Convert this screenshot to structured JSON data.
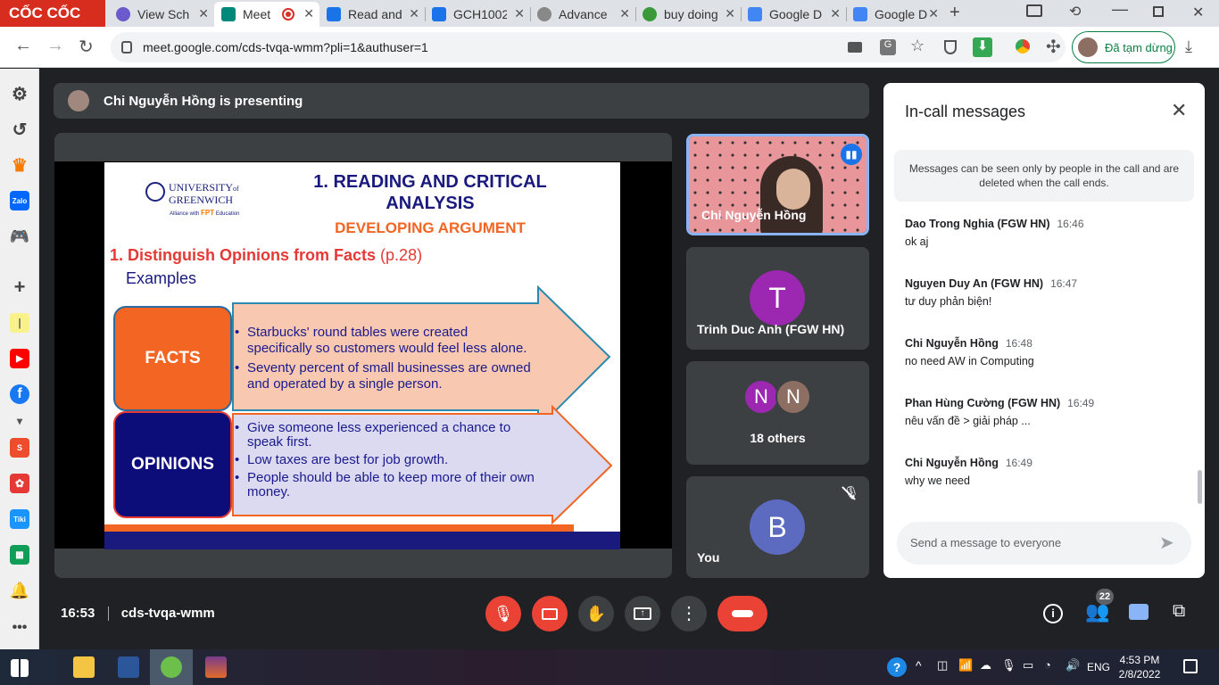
{
  "browser": {
    "logo": "CỐC CỐC",
    "tabs": [
      {
        "label": "View Sch",
        "icon": "view-schedule-icon",
        "color": "#6a5acd"
      },
      {
        "label": "Meet",
        "icon": "meet-icon",
        "color": "#00897b",
        "active": true
      },
      {
        "label": "Read and",
        "icon": "docs-icon",
        "color": "#1a73e8"
      },
      {
        "label": "GCH1002",
        "icon": "docs-icon",
        "color": "#1a73e8"
      },
      {
        "label": "Advance",
        "icon": "globe-icon",
        "color": "#888888"
      },
      {
        "label": "buy doing",
        "icon": "coccoc-icon",
        "color": "#3a9a3a"
      },
      {
        "label": "Google D",
        "icon": "google-translate-icon",
        "color": "#4285f4"
      },
      {
        "label": "Google D",
        "icon": "google-translate-icon",
        "color": "#4285f4"
      }
    ],
    "url": "meet.google.com/cds-tvqa-wmm?pli=1&authuser=1",
    "pause_label": "Đã tạm dừng"
  },
  "meet": {
    "presenting_text": "Chi Nguyễn Hồng is presenting",
    "slide": {
      "logo_line1": "UNIVERSITY",
      "logo_of": "of",
      "logo_line2": "GREENWICH",
      "logo_alliance": "Alliance with",
      "logo_fpt": "FPT",
      "logo_edu": "Education",
      "title_line1": "1. READING AND CRITICAL",
      "title_line2": "ANALYSIS",
      "subtitle": "DEVELOPING ARGUMENT",
      "heading": "1. Distinguish Opinions from Facts",
      "heading_page": "(p.28)",
      "examples": "Examples",
      "facts_label": "FACTS",
      "opinions_label": "OPINIONS",
      "facts": [
        {
          "line1": "Starbucks' round tables were created",
          "line2": "specifically so customers would feel less alone."
        },
        {
          "line1": "Seventy percent of small businesses are owned",
          "line2": "and operated by a single person."
        }
      ],
      "opinions": [
        {
          "line1": "Give someone less experienced a chance to",
          "line2": "speak first."
        },
        {
          "line1": "Low taxes are best for job growth.",
          "line2": ""
        },
        {
          "line1": "People should be able to keep more of their own",
          "line2": "money."
        }
      ]
    },
    "tiles": {
      "presenter_name": "Chi Nguyễn Hồng",
      "t_initial": "T",
      "t_name": "Trinh Duc Anh (FGW HN)",
      "others_initials": [
        "N",
        "N"
      ],
      "others_label": "18 others",
      "you_initial": "B",
      "you_label": "You"
    },
    "chat": {
      "title": "In-call messages",
      "notice": "Messages can be seen only by people in the call and are deleted when the call ends.",
      "messages": [
        {
          "sender": "Dao Trong Nghia (FGW HN)",
          "time": "16:46",
          "text": "ok aj"
        },
        {
          "sender": "Nguyen Duy An (FGW HN)",
          "time": "16:47",
          "text": "tư duy phản biện!"
        },
        {
          "sender": "Chi Nguyễn Hồng",
          "time": "16:48",
          "text": "no need AW in Computing"
        },
        {
          "sender": "Phan Hùng Cường (FGW HN)",
          "time": "16:49",
          "text": "nêu vấn đề > giải pháp ..."
        },
        {
          "sender": "Chi Nguyễn Hồng",
          "time": "16:49",
          "text": "why we need"
        }
      ],
      "input_placeholder": "Send a message to everyone"
    },
    "bottom": {
      "time": "16:53",
      "meeting_code": "cds-tvqa-wmm",
      "people_count": "22"
    }
  },
  "taskbar": {
    "lang": "ENG",
    "time": "4:53 PM",
    "date": "2/8/2022"
  }
}
